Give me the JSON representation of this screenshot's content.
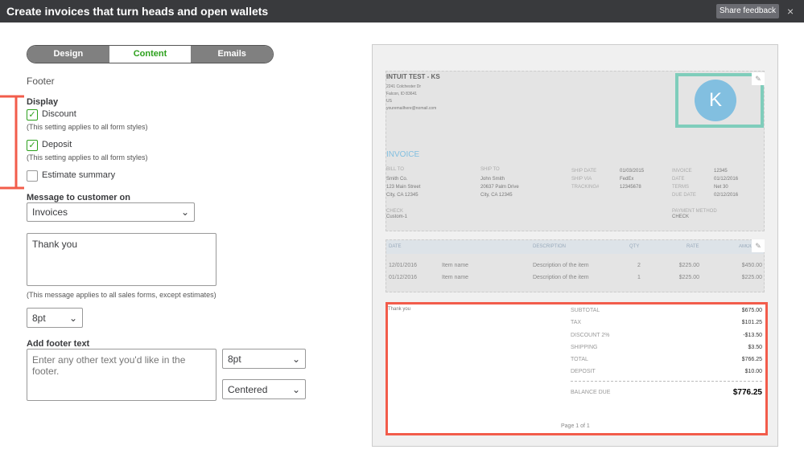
{
  "header": {
    "title": "Create invoices that turn heads and open wallets",
    "share_label": "Share feedback",
    "close": "×"
  },
  "tabs": [
    "Design",
    "Content",
    "Emails"
  ],
  "footer_section": {
    "heading": "Footer",
    "display_label": "Display",
    "options": [
      {
        "label": "Discount",
        "checked": true,
        "note": "(This setting applies to all form styles)"
      },
      {
        "label": "Deposit",
        "checked": true,
        "note": "(This setting applies to all form styles)"
      },
      {
        "label": "Estimate summary",
        "checked": false
      }
    ],
    "message_label": "Message to customer on",
    "message_select": "Invoices",
    "message_value": "Thank you",
    "message_note": "(This message applies to all sales forms, except estimates)",
    "message_size": "8pt",
    "footer_text_label": "Add footer text",
    "footer_text_placeholder": "Enter any other text you'd like in the footer.",
    "footer_size": "8pt",
    "footer_align": "Centered"
  },
  "invoice": {
    "company": "INTUIT TEST - KS",
    "address": [
      "2241 Colchester Dr",
      "Falcon, ID 83641",
      "US",
      "youremailhere@nomail.com"
    ],
    "logo_letter": "K",
    "doc_title": "INVOICE",
    "bill_to_label": "BILL TO",
    "bill_to": [
      "Smith Co.",
      "123 Main Street",
      "City, CA 12345"
    ],
    "ship_to_label": "SHIP TO",
    "ship_to": [
      "John Smith",
      "20637 Palm Drive",
      "City, CA 12345"
    ],
    "ship_fields": [
      [
        "SHIP DATE",
        "01/03/2015"
      ],
      [
        "SHIP VIA",
        "FedEx"
      ],
      [
        "TRACKING#",
        "12345678"
      ]
    ],
    "inv_fields": [
      [
        "INVOICE",
        "12345"
      ],
      [
        "DATE",
        "01/12/2016"
      ],
      [
        "TERMS",
        "Net 30"
      ],
      [
        "DUE DATE",
        "02/12/2016"
      ]
    ],
    "check_label": "CHECK",
    "check_value": "Custom-1",
    "pay_label": "PAYMENT METHOD",
    "pay_value": "CHECK",
    "columns": [
      "DATE",
      "DESCRIPTION",
      "QTY",
      "RATE",
      "AMOUNT"
    ],
    "rows": [
      [
        "12/01/2016",
        "Item name",
        "Description of the item",
        "2",
        "$225.00",
        "$450.00"
      ],
      [
        "01/12/2016",
        "Item name",
        "Description of the item",
        "1",
        "$225.00",
        "$225.00"
      ]
    ],
    "message": "Thank you",
    "totals": [
      [
        "SUBTOTAL",
        "$675.00"
      ],
      [
        "TAX",
        "$101.25"
      ],
      [
        "DISCOUNT 2%",
        "-$13.50"
      ],
      [
        "SHIPPING",
        "$3.50"
      ],
      [
        "TOTAL",
        "$766.25"
      ],
      [
        "DEPOSIT",
        "$10.00"
      ]
    ],
    "balance_label": "BALANCE DUE",
    "balance": "$776.25",
    "page": "Page 1 of 1"
  },
  "colors": {
    "accent": "#2ca01c",
    "highlight": "#f25c4b",
    "logo": "#82bfe0",
    "logo_border": "#7fcdbb"
  }
}
